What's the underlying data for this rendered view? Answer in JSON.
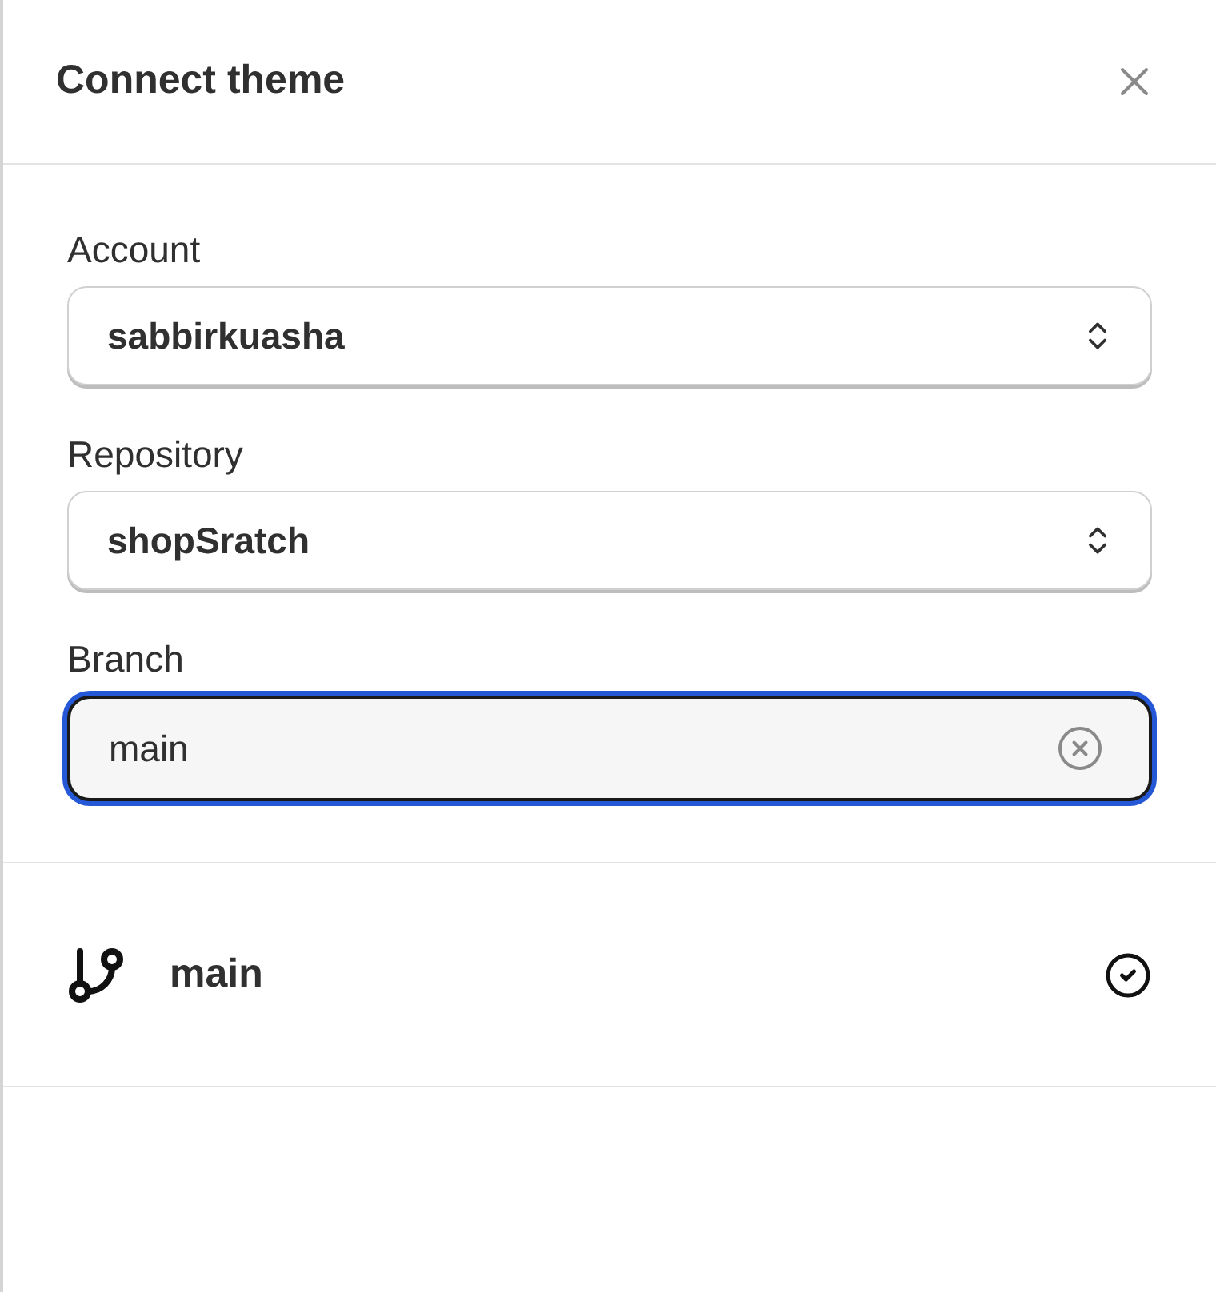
{
  "dialog": {
    "title": "Connect theme"
  },
  "fields": [
    {
      "kind": "select",
      "label": "Account",
      "value": "sabbirkuasha"
    },
    {
      "kind": "select",
      "label": "Repository",
      "value": "shopSratch"
    },
    {
      "kind": "search",
      "label": "Branch",
      "value": "main",
      "focused": true
    }
  ],
  "branches": [
    {
      "name": "main",
      "selected": true
    }
  ]
}
